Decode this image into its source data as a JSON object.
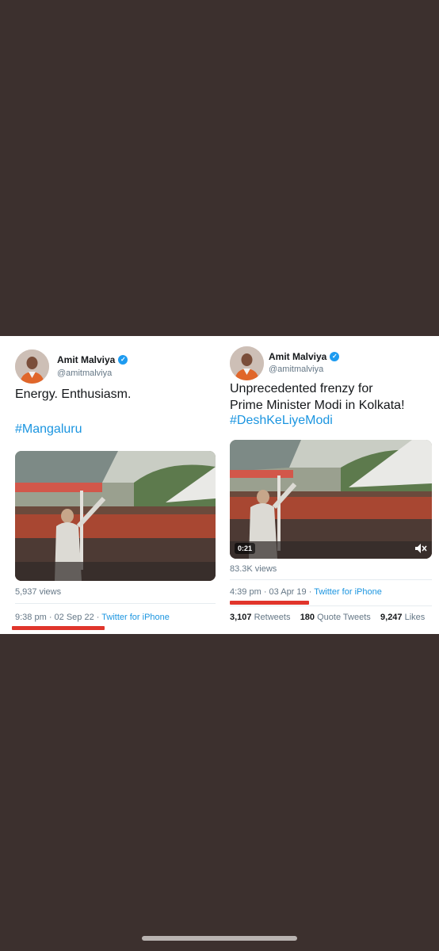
{
  "left_tweet": {
    "name": "Amit Malviya",
    "handle": "@amitmalviya",
    "text": "Energy. Enthusiasm.",
    "hashtag": "#Mangaluru",
    "views": "5,937 views",
    "time": "9:38 pm",
    "date": "02 Sep 22",
    "source": "Twitter for iPhone"
  },
  "right_tweet": {
    "name": "Amit Malviya",
    "handle": "@amitmalviya",
    "text_line1": "Unprecedented frenzy for",
    "text_line2": "Prime Minister Modi in Kolkata!",
    "hashtag": "#DeshKeLiyeModi",
    "video_duration": "0:21",
    "views": "83.3K views",
    "time": "4:39 pm",
    "date": "03 Apr 19",
    "source": "Twitter for iPhone",
    "retweets_count": "3,107",
    "retweets_label": "Retweets",
    "quotes_count": "180",
    "quotes_label": "Quote Tweets",
    "likes_count": "9,247",
    "likes_label": "Likes"
  },
  "colors": {
    "background": "#3c302e",
    "highlight_underline": "#e0352b",
    "link": "#1b95e0",
    "verified": "#1d9bf0"
  },
  "icons": [
    "verified-badge-icon",
    "mute-icon"
  ]
}
